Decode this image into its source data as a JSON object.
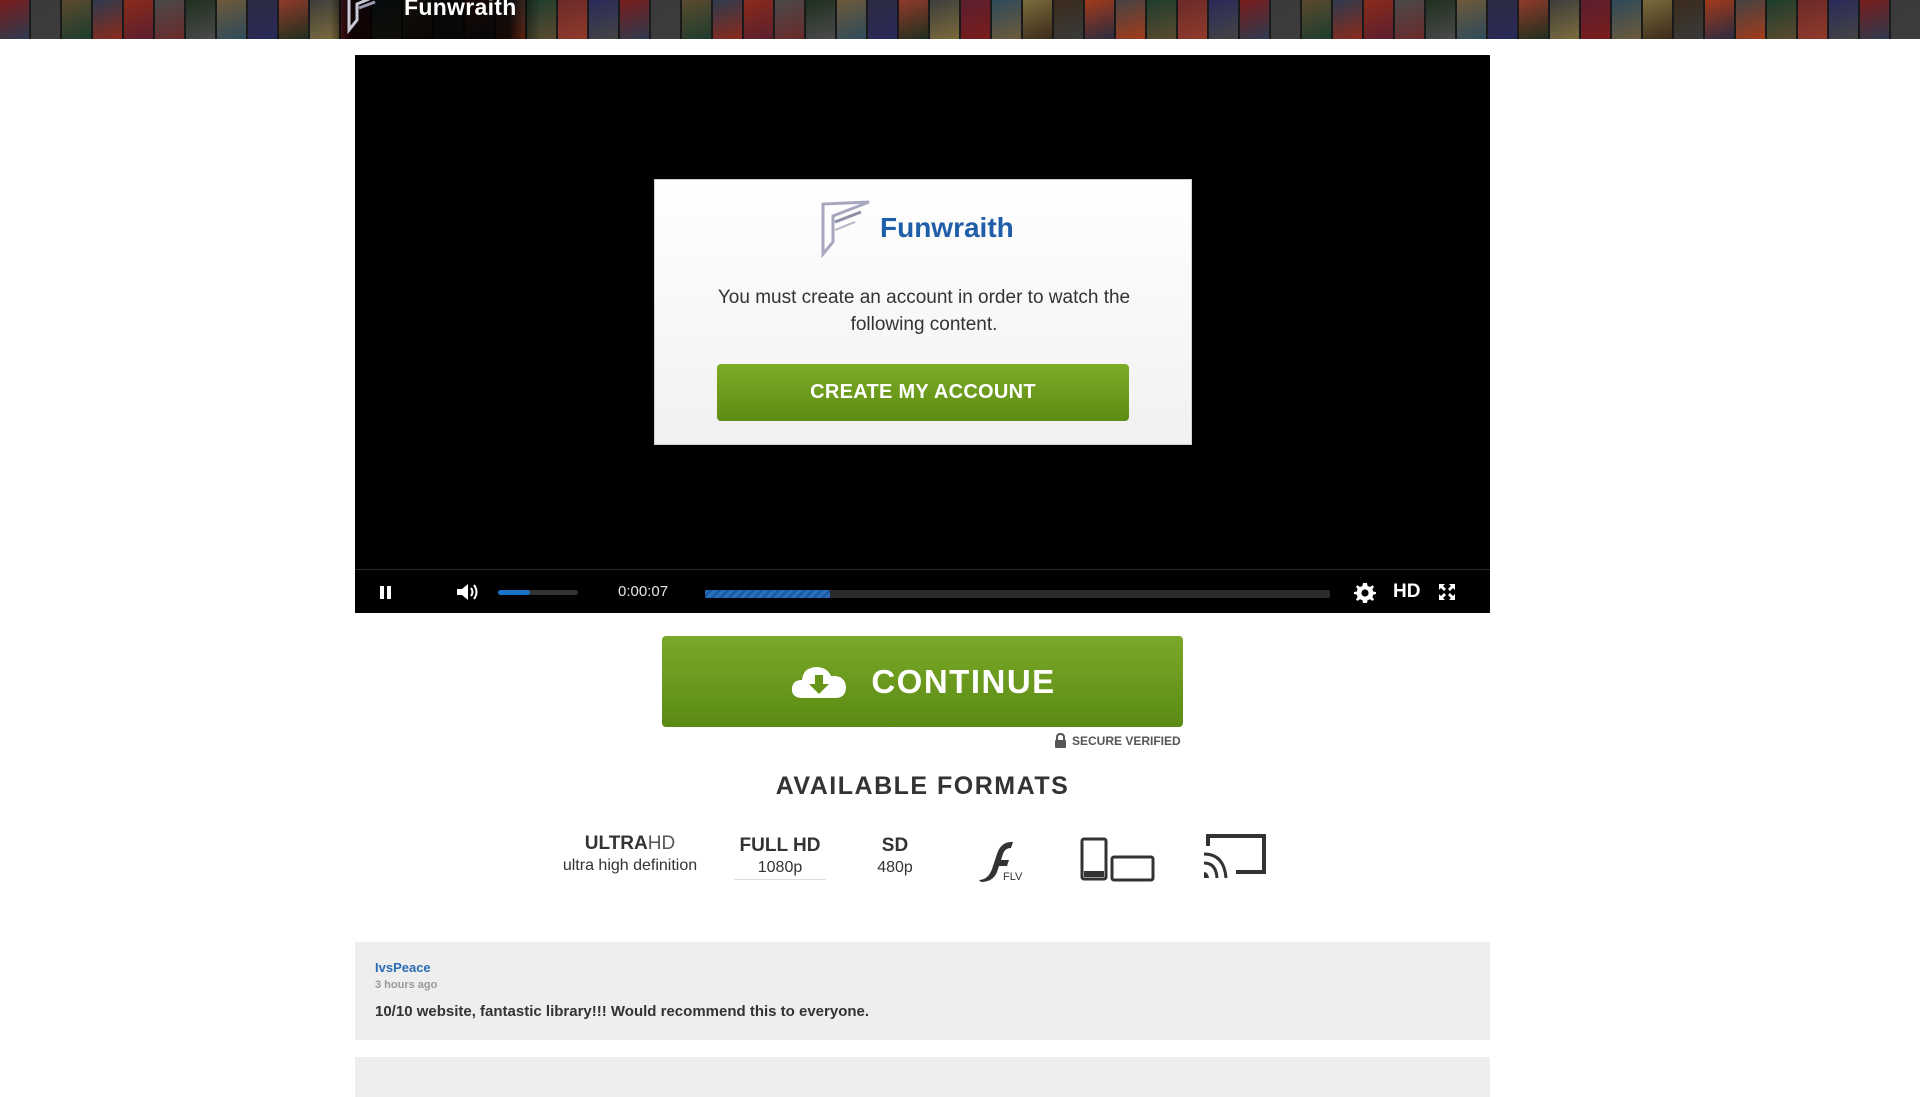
{
  "header": {
    "title": "Funwraith",
    "poster_colors": [
      "#7a1c1c",
      "#3a3a3a",
      "#5b4a2e",
      "#2d3b4f",
      "#8b2a1a",
      "#4a4a4a",
      "#1f2f1f",
      "#6d5a3a",
      "#2b2b40",
      "#913a2a",
      "#3d3d3d",
      "#5a1f2e",
      "#2e4a5a",
      "#7b6b3b",
      "#3b2b1b",
      "#a33a1a",
      "#444444",
      "#1d3d2d",
      "#6a2a2a",
      "#2a2a5a"
    ]
  },
  "player": {
    "modal": {
      "brand": "Funwraith",
      "message": "You must create an account in order to watch the following content.",
      "button": "CREATE MY ACCOUNT"
    },
    "controls": {
      "time": "0:00:07",
      "quality": "HD",
      "volume_fraction": 0.4,
      "progress_fraction": 0.2
    }
  },
  "continue_label": "CONTINUE",
  "secure_label": "SECURE VERIFIED",
  "formats_title": "AVAILABLE FORMATS",
  "formats": {
    "ultra": {
      "bold": "ULTRA",
      "thin": "HD",
      "sub": "ultra high definition"
    },
    "full": {
      "name": "FULL HD",
      "sub": "1080p"
    },
    "sd": {
      "name": "SD",
      "sub": "480p"
    },
    "flv": {
      "label": "FLV"
    }
  },
  "comments": [
    {
      "author": "IvsPeace",
      "time": "3 hours ago",
      "text": "10/10 website, fantastic library!!! Would recommend this to everyone."
    },
    {
      "author": "",
      "time": "",
      "text": ""
    }
  ],
  "colors": {
    "accent_green": "#6b9a1c",
    "brand_blue": "#1f5ea8",
    "progress_blue": "#2b6fbf"
  }
}
